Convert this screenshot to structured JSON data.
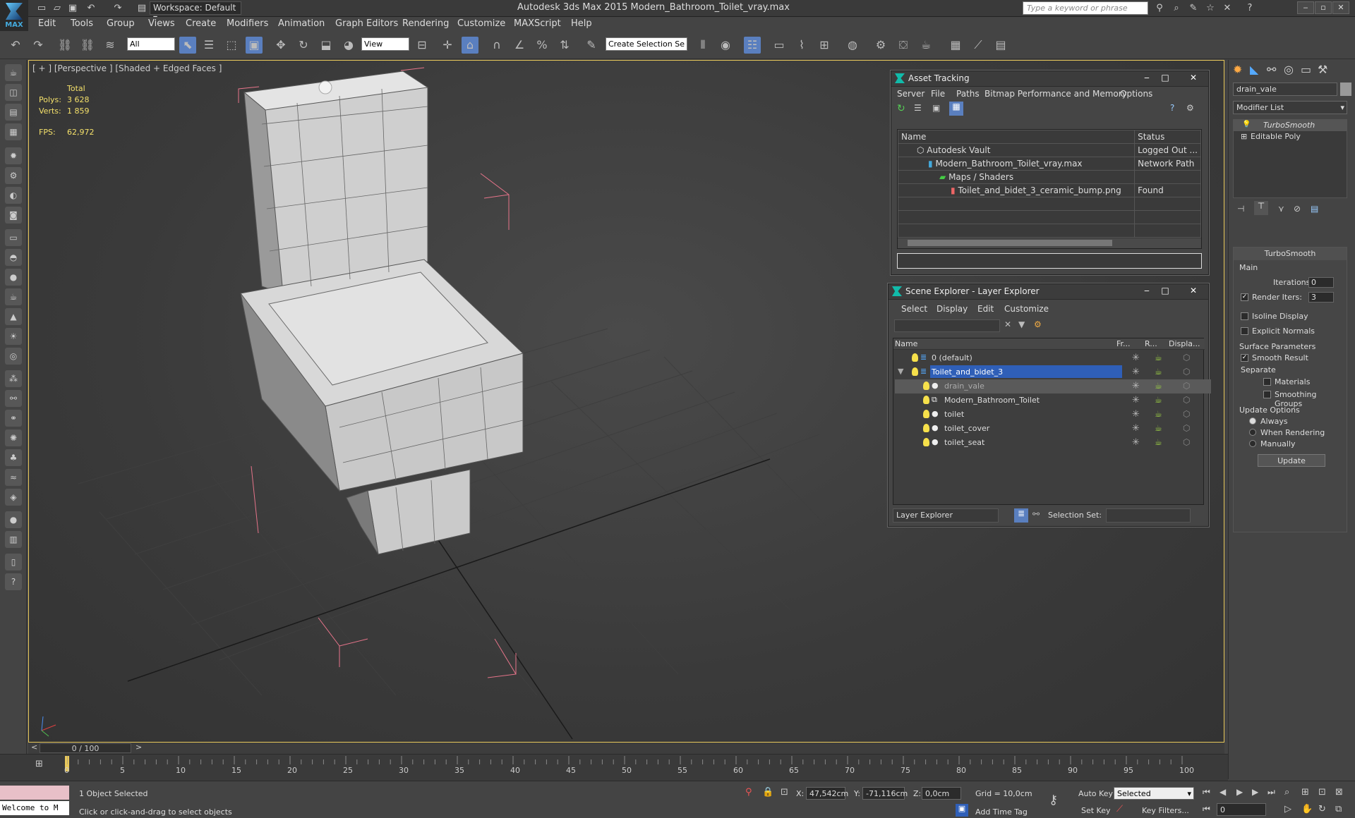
{
  "app": {
    "workspace": "Workspace: Default",
    "window_title": "Autodesk 3ds Max  2015    Modern_Bathroom_Toilet_vray.max",
    "search_placeholder": "Type a keyword or phrase",
    "logo_text": "MAX"
  },
  "menu": [
    "Edit",
    "Tools",
    "Group",
    "Views",
    "Create",
    "Modifiers",
    "Animation",
    "Graph Editors",
    "Rendering",
    "Customize",
    "MAXScript",
    "Help"
  ],
  "toolbar": {
    "filter_value": "All",
    "ref_coord_value": "View",
    "selection_set_placeholder": "Create Selection Se"
  },
  "viewport": {
    "label": "[ + ] [Perspective ] [Shaded + Edged Faces ]",
    "stats": {
      "total_label": "Total",
      "polys_label": "Polys:",
      "polys_value": "3 628",
      "verts_label": "Verts:",
      "verts_value": "1 859",
      "fps_label": "FPS:",
      "fps_value": "62,972"
    }
  },
  "asset_tracking": {
    "title": "Asset Tracking",
    "menu": [
      "Server",
      "File",
      "Paths",
      "Bitmap Performance and Memory",
      "Options"
    ],
    "columns": [
      "Name",
      "Status"
    ],
    "rows": [
      {
        "name": "Autodesk Vault",
        "status": "Logged Out ..."
      },
      {
        "name": "Modern_Bathroom_Toilet_vray.max",
        "status": "Network Path"
      },
      {
        "name": "Maps / Shaders",
        "status": ""
      },
      {
        "name": "Toilet_and_bidet_3_ceramic_bump.png",
        "status": "Found"
      }
    ]
  },
  "scene_explorer": {
    "title": "Scene Explorer - Layer Explorer",
    "menu": [
      "Select",
      "Display",
      "Edit",
      "Customize"
    ],
    "columns": [
      "Name",
      "Fr...",
      "R...",
      "Displa..."
    ],
    "rows": [
      {
        "name": "0 (default)"
      },
      {
        "name": "Toilet_and_bidet_3"
      },
      {
        "name": "drain_vale"
      },
      {
        "name": "Modern_Bathroom_Toilet"
      },
      {
        "name": "toilet"
      },
      {
        "name": "toilet_cover"
      },
      {
        "name": "toilet_seat"
      }
    ],
    "footer_mode": "Layer Explorer",
    "selection_set_label": "Selection Set:"
  },
  "command_panel": {
    "object_name": "drain_vale",
    "modifier_list": "Modifier List",
    "stack": [
      "TurboSmooth",
      "Editable Poly"
    ],
    "rollout_title": "TurboSmooth",
    "main_label": "Main",
    "iterations_label": "Iterations:",
    "iterations_value": "0",
    "render_iters_label": "Render Iters:",
    "render_iters_value": "3",
    "isoline_label": "Isoline Display",
    "explicit_normals_label": "Explicit Normals",
    "surface_params_label": "Surface Parameters",
    "smooth_result_label": "Smooth Result",
    "separate_label": "Separate",
    "materials_label": "Materials",
    "smoothing_groups_label": "Smoothing Groups",
    "update_options_label": "Update Options",
    "always_label": "Always",
    "when_rendering_label": "When Rendering",
    "manually_label": "Manually",
    "update_button": "Update"
  },
  "timeline": {
    "frame_counter": "0 / 100",
    "ticks": [
      "0",
      "5",
      "10",
      "15",
      "20",
      "25",
      "30",
      "35",
      "40",
      "45",
      "50",
      "55",
      "60",
      "65",
      "70",
      "75",
      "80",
      "85",
      "90",
      "95",
      "100"
    ]
  },
  "status": {
    "listener_text": "Welcome to M",
    "selection_info": "1 Object Selected",
    "prompt": "Click or click-and-drag to select objects",
    "x_label": "X:",
    "x_value": "47,542cm",
    "y_label": "Y:",
    "y_value": "-71,116cm",
    "z_label": "Z:",
    "z_value": "0,0cm",
    "grid": "Grid = 10,0cm",
    "add_time_tag": "Add Time Tag",
    "auto_key": "Auto Key",
    "set_key": "Set Key",
    "key_mode_value": "Selected",
    "key_filters": "Key Filters...",
    "frame_value": "0"
  },
  "colors": {
    "viewport_border": "#e8c85a",
    "stats_text": "#f4e06a",
    "selection_highlight": "#2f5fb8",
    "bounding_box": "#e6748a"
  }
}
